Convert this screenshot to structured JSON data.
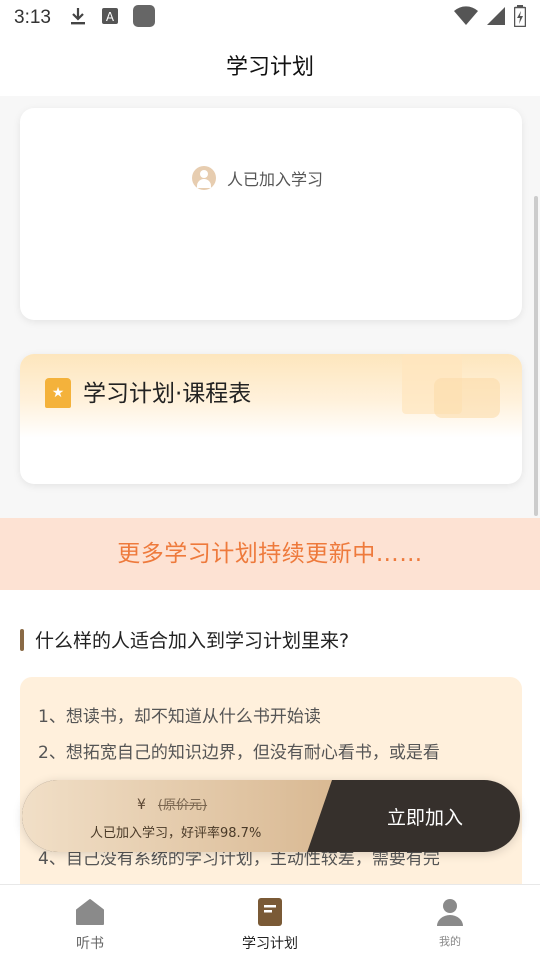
{
  "status_bar": {
    "time": "3:13",
    "icons": [
      "download-icon",
      "a-icon",
      "app-square-icon",
      "wifi-icon",
      "signal-icon",
      "battery-icon"
    ]
  },
  "header": {
    "title": "学习计划"
  },
  "card_joined": {
    "text": "人已加入学习"
  },
  "card_plan": {
    "title": "学习计划·课程表"
  },
  "banner": {
    "text": "更多学习计划持续更新中……"
  },
  "section": {
    "title": "什么样的人适合加入到学习计划里来?",
    "items": [
      "1、想读书，却不知道从什么书开始读",
      "2、想拓宽自己的知识边界，但没有耐心看书，或是看",
      "4、自己没有系统的学习计划，主动性较差，需要有完"
    ]
  },
  "join_bar": {
    "currency": "¥",
    "original_price": "(原价元)",
    "stats": "人已加入学习，好评率98.7%",
    "button": "立即加入"
  },
  "tabs": [
    {
      "label": "听书",
      "icon": "home-icon",
      "active": false
    },
    {
      "label": "学习计划",
      "icon": "book-icon",
      "active": true
    },
    {
      "label": "我的",
      "icon": "user-icon",
      "active": false
    }
  ],
  "colors": {
    "accent_orange": "#ee7a3c",
    "banner_bg": "#fde2d3",
    "list_bg": "#fff0dc",
    "join_dark": "#36302c",
    "join_gold": "#d9b993",
    "badge": "#f4b23b"
  }
}
